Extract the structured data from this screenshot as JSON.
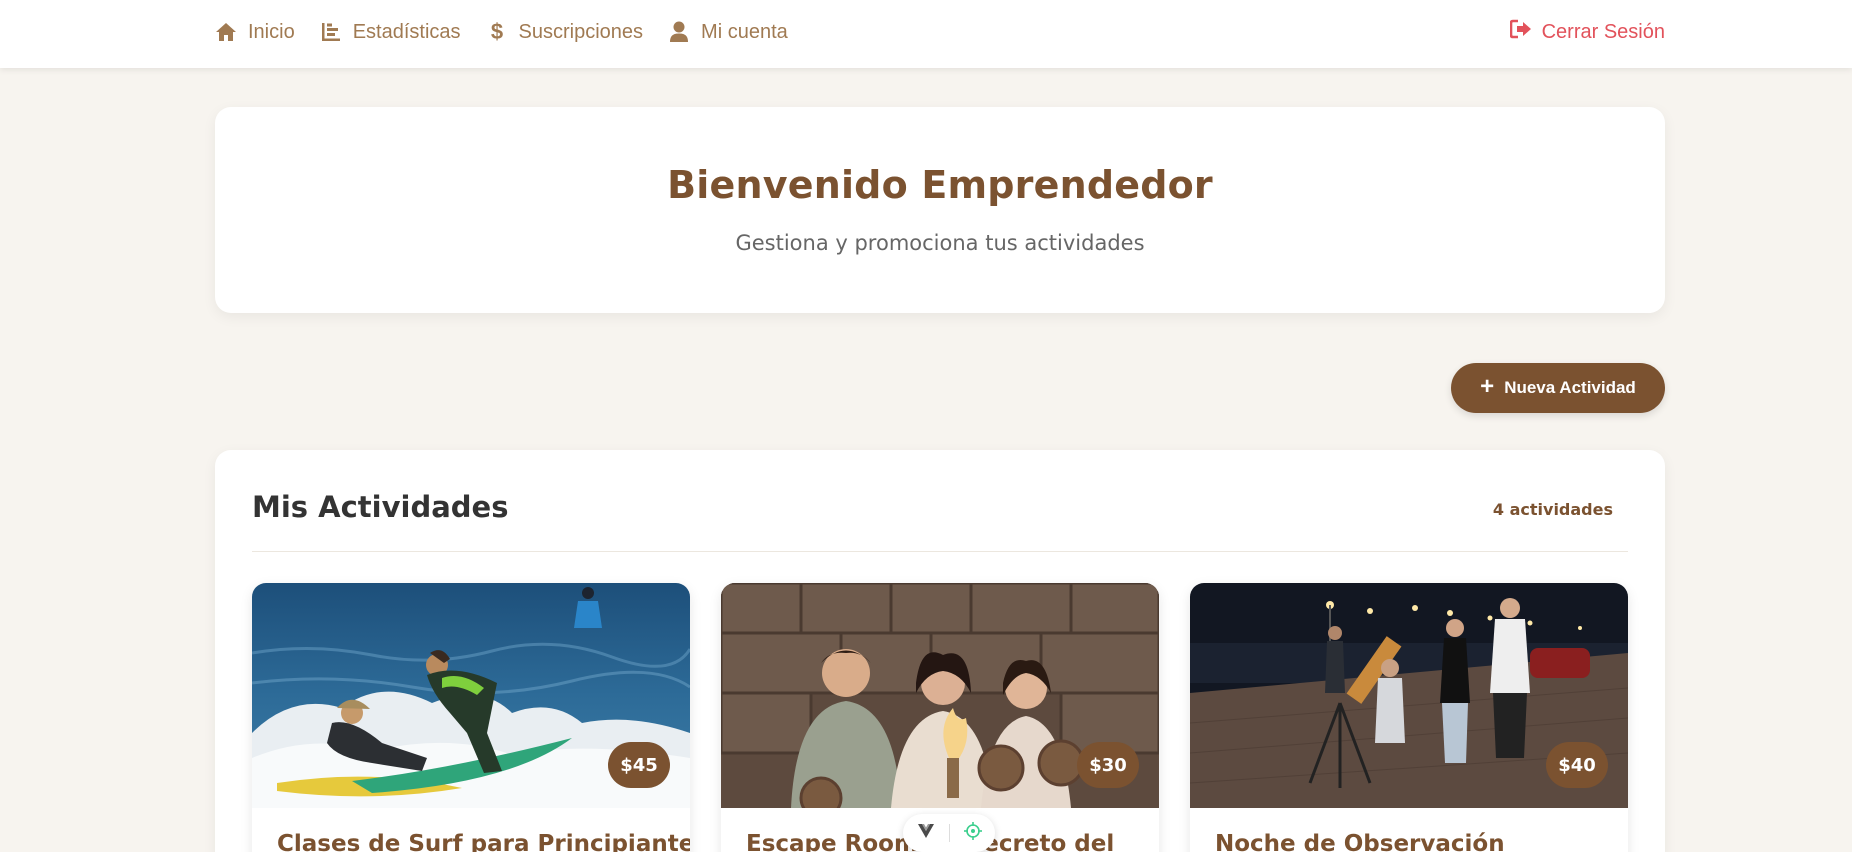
{
  "navbar": {
    "items": [
      {
        "label": "Inicio",
        "icon": "home-icon"
      },
      {
        "label": "Estadísticas",
        "icon": "bar-chart-icon"
      },
      {
        "label": "Suscripciones",
        "icon": "dollar-icon"
      },
      {
        "label": "Mi cuenta",
        "icon": "user-icon"
      }
    ],
    "logout_label": "Cerrar Sesión",
    "logout_icon": "sign-out-icon"
  },
  "welcome": {
    "title": "Bienvenido Emprendedor",
    "subtitle": "Gestiona y promociona tus actividades"
  },
  "new_activity_label": "Nueva Actividad",
  "activities": {
    "title": "Mis Actividades",
    "count_label": "4 actividades",
    "cards": [
      {
        "title": "Clases de Surf para Principiantes",
        "price": "$45",
        "image": "surf-lesson-photo"
      },
      {
        "title": "Escape Room: El Secreto del",
        "price": "$30",
        "image": "escape-room-photo"
      },
      {
        "title": "Noche de Observación",
        "price": "$40",
        "image": "stargazing-photo"
      }
    ]
  },
  "colors": {
    "brand": "#7b5230",
    "nav_text": "#a07a52",
    "logout": "#e2525b",
    "background": "#f7f4ef"
  }
}
